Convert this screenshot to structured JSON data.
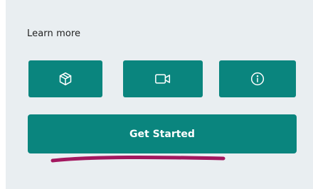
{
  "section": {
    "heading": "Learn more"
  },
  "icon_buttons": [
    {
      "icon": "box-icon"
    },
    {
      "icon": "video-icon"
    },
    {
      "icon": "info-icon"
    }
  ],
  "cta": {
    "label": "Get Started"
  },
  "colors": {
    "accent": "#0a857e",
    "panel": "#e9eef1",
    "annotation": "#a3175f"
  }
}
